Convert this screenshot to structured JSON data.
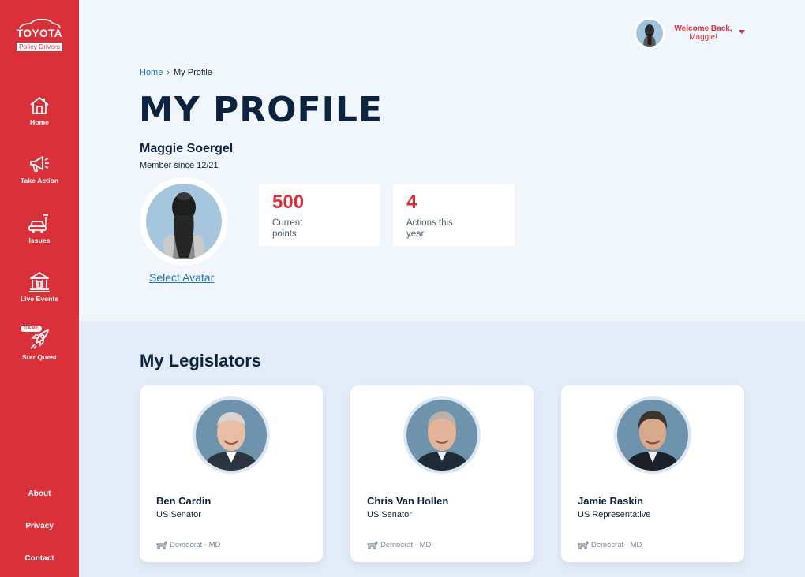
{
  "brand": {
    "name": "TOYOTA",
    "subtitle": "Policy Drivers"
  },
  "sidebar": {
    "items": [
      {
        "label": "Home",
        "icon": "home-icon"
      },
      {
        "label": "Take Action",
        "icon": "megaphone-icon"
      },
      {
        "label": "Issues",
        "icon": "electric-car-icon"
      },
      {
        "label": "Live Events",
        "icon": "capitol-building-icon"
      },
      {
        "label": "Star Quest",
        "icon": "rocket-icon",
        "badge": "GAME"
      }
    ],
    "footer": [
      "About",
      "Privacy",
      "Contact"
    ]
  },
  "header": {
    "welcome_line1": "Welcome Back,",
    "welcome_line2": "Maggie!"
  },
  "breadcrumb": {
    "home": "Home",
    "current": "My Profile"
  },
  "page": {
    "title": "MY PROFILE",
    "user_name": "Maggie Soergel",
    "member_since": "Member since 12/21",
    "select_avatar": "Select Avatar"
  },
  "stats": [
    {
      "value": "500",
      "label": "Current points"
    },
    {
      "value": "4",
      "label": "Actions this year"
    }
  ],
  "legislators_title": "My Legislators",
  "legislators": [
    {
      "name": "Ben Cardin",
      "role": "US Senator",
      "party": "Democrat - MD"
    },
    {
      "name": "Chris Van Hollen",
      "role": "US Senator",
      "party": "Democrat - MD"
    },
    {
      "name": "Jamie Raskin",
      "role": "US Representative",
      "party": "Democrat - MD"
    }
  ],
  "colors": {
    "brand_red": "#da3039",
    "navy": "#0c2340",
    "link_blue": "#1a75bc"
  }
}
